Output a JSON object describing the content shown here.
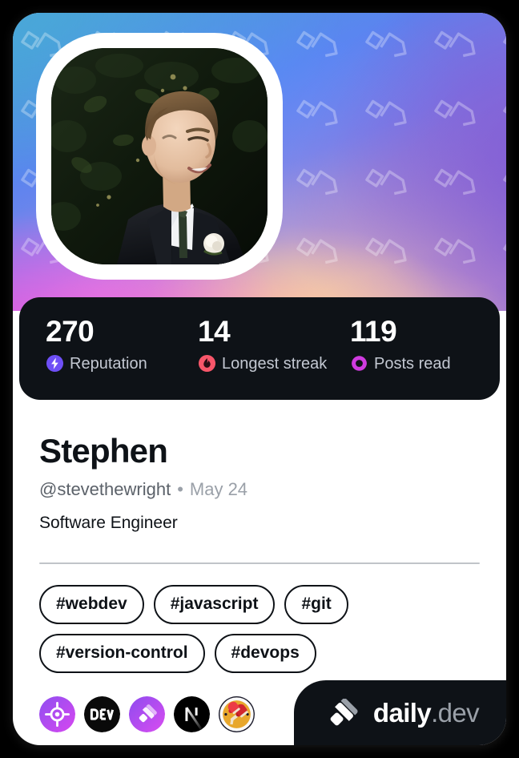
{
  "card": {
    "cover_alt": "profile-cover-gradient"
  },
  "profile": {
    "avatar_alt": "Stephen portrait photo",
    "name": "Stephen",
    "handle": "@stevethewright",
    "separator": "•",
    "joined": "May 24",
    "job_title": "Software Engineer"
  },
  "stats": [
    {
      "value": "270",
      "label": "Reputation",
      "icon": "reputation-bolt-icon",
      "color": "#6e4ff6"
    },
    {
      "value": "14",
      "label": "Longest streak",
      "icon": "streak-flame-icon",
      "color": "#f8566a"
    },
    {
      "value": "119",
      "label": "Posts read",
      "icon": "posts-read-eye-icon",
      "color": "#cf3bdf"
    }
  ],
  "tags": [
    {
      "label": "#webdev"
    },
    {
      "label": "#javascript"
    },
    {
      "label": "#git"
    },
    {
      "label": "#version-control"
    },
    {
      "label": "#devops"
    }
  ],
  "badges": [
    {
      "name": "target-crosshair-badge"
    },
    {
      "name": "devto-badge"
    },
    {
      "name": "dailydev-badge"
    },
    {
      "name": "nextjs-badge"
    },
    {
      "name": "boxing-gloves-badge"
    }
  ],
  "footer": {
    "brand_primary": "daily",
    "brand_secondary": ".dev",
    "logo": "dailydev-logo-mark"
  },
  "colors": {
    "dark": "#0e1217",
    "text_primary": "#0e1217",
    "text_muted": "#9aa0a8",
    "divider": "#c0c4c9"
  }
}
